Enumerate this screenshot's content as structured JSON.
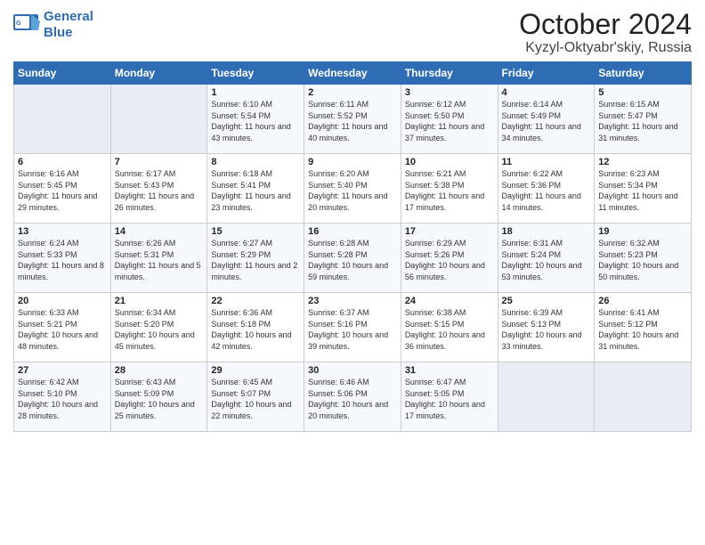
{
  "header": {
    "logo_line1": "General",
    "logo_line2": "Blue",
    "month": "October 2024",
    "location": "Kyzyl-Oktyabr'skiy, Russia"
  },
  "days_of_week": [
    "Sunday",
    "Monday",
    "Tuesday",
    "Wednesday",
    "Thursday",
    "Friday",
    "Saturday"
  ],
  "weeks": [
    [
      {
        "day": "",
        "info": ""
      },
      {
        "day": "",
        "info": ""
      },
      {
        "day": "1",
        "info": "Sunrise: 6:10 AM\nSunset: 5:54 PM\nDaylight: 11 hours and 43 minutes."
      },
      {
        "day": "2",
        "info": "Sunrise: 6:11 AM\nSunset: 5:52 PM\nDaylight: 11 hours and 40 minutes."
      },
      {
        "day": "3",
        "info": "Sunrise: 6:12 AM\nSunset: 5:50 PM\nDaylight: 11 hours and 37 minutes."
      },
      {
        "day": "4",
        "info": "Sunrise: 6:14 AM\nSunset: 5:49 PM\nDaylight: 11 hours and 34 minutes."
      },
      {
        "day": "5",
        "info": "Sunrise: 6:15 AM\nSunset: 5:47 PM\nDaylight: 11 hours and 31 minutes."
      }
    ],
    [
      {
        "day": "6",
        "info": "Sunrise: 6:16 AM\nSunset: 5:45 PM\nDaylight: 11 hours and 29 minutes."
      },
      {
        "day": "7",
        "info": "Sunrise: 6:17 AM\nSunset: 5:43 PM\nDaylight: 11 hours and 26 minutes."
      },
      {
        "day": "8",
        "info": "Sunrise: 6:18 AM\nSunset: 5:41 PM\nDaylight: 11 hours and 23 minutes."
      },
      {
        "day": "9",
        "info": "Sunrise: 6:20 AM\nSunset: 5:40 PM\nDaylight: 11 hours and 20 minutes."
      },
      {
        "day": "10",
        "info": "Sunrise: 6:21 AM\nSunset: 5:38 PM\nDaylight: 11 hours and 17 minutes."
      },
      {
        "day": "11",
        "info": "Sunrise: 6:22 AM\nSunset: 5:36 PM\nDaylight: 11 hours and 14 minutes."
      },
      {
        "day": "12",
        "info": "Sunrise: 6:23 AM\nSunset: 5:34 PM\nDaylight: 11 hours and 11 minutes."
      }
    ],
    [
      {
        "day": "13",
        "info": "Sunrise: 6:24 AM\nSunset: 5:33 PM\nDaylight: 11 hours and 8 minutes."
      },
      {
        "day": "14",
        "info": "Sunrise: 6:26 AM\nSunset: 5:31 PM\nDaylight: 11 hours and 5 minutes."
      },
      {
        "day": "15",
        "info": "Sunrise: 6:27 AM\nSunset: 5:29 PM\nDaylight: 11 hours and 2 minutes."
      },
      {
        "day": "16",
        "info": "Sunrise: 6:28 AM\nSunset: 5:28 PM\nDaylight: 10 hours and 59 minutes."
      },
      {
        "day": "17",
        "info": "Sunrise: 6:29 AM\nSunset: 5:26 PM\nDaylight: 10 hours and 56 minutes."
      },
      {
        "day": "18",
        "info": "Sunrise: 6:31 AM\nSunset: 5:24 PM\nDaylight: 10 hours and 53 minutes."
      },
      {
        "day": "19",
        "info": "Sunrise: 6:32 AM\nSunset: 5:23 PM\nDaylight: 10 hours and 50 minutes."
      }
    ],
    [
      {
        "day": "20",
        "info": "Sunrise: 6:33 AM\nSunset: 5:21 PM\nDaylight: 10 hours and 48 minutes."
      },
      {
        "day": "21",
        "info": "Sunrise: 6:34 AM\nSunset: 5:20 PM\nDaylight: 10 hours and 45 minutes."
      },
      {
        "day": "22",
        "info": "Sunrise: 6:36 AM\nSunset: 5:18 PM\nDaylight: 10 hours and 42 minutes."
      },
      {
        "day": "23",
        "info": "Sunrise: 6:37 AM\nSunset: 5:16 PM\nDaylight: 10 hours and 39 minutes."
      },
      {
        "day": "24",
        "info": "Sunrise: 6:38 AM\nSunset: 5:15 PM\nDaylight: 10 hours and 36 minutes."
      },
      {
        "day": "25",
        "info": "Sunrise: 6:39 AM\nSunset: 5:13 PM\nDaylight: 10 hours and 33 minutes."
      },
      {
        "day": "26",
        "info": "Sunrise: 6:41 AM\nSunset: 5:12 PM\nDaylight: 10 hours and 31 minutes."
      }
    ],
    [
      {
        "day": "27",
        "info": "Sunrise: 6:42 AM\nSunset: 5:10 PM\nDaylight: 10 hours and 28 minutes."
      },
      {
        "day": "28",
        "info": "Sunrise: 6:43 AM\nSunset: 5:09 PM\nDaylight: 10 hours and 25 minutes."
      },
      {
        "day": "29",
        "info": "Sunrise: 6:45 AM\nSunset: 5:07 PM\nDaylight: 10 hours and 22 minutes."
      },
      {
        "day": "30",
        "info": "Sunrise: 6:46 AM\nSunset: 5:06 PM\nDaylight: 10 hours and 20 minutes."
      },
      {
        "day": "31",
        "info": "Sunrise: 6:47 AM\nSunset: 5:05 PM\nDaylight: 10 hours and 17 minutes."
      },
      {
        "day": "",
        "info": ""
      },
      {
        "day": "",
        "info": ""
      }
    ]
  ]
}
